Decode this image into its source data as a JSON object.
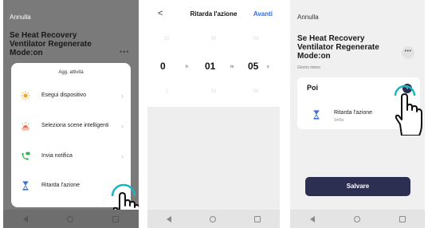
{
  "screen1": {
    "cancel": "Annulla",
    "title": "Se Heat Recovery Ventilator Regenerate Mode:on",
    "more": "•••",
    "sheet_title": "Agg. attività",
    "items": [
      {
        "label": "Esegui dispositivo",
        "icon": "sun-device-icon",
        "color": "#f5a623"
      },
      {
        "label": "Seleziona scene intelligenti",
        "icon": "sunrise-scene-icon",
        "color": "#f06a3c"
      },
      {
        "label": "Invia notifica",
        "icon": "phone-message-icon",
        "color": "#2db34a"
      },
      {
        "label": "Ritarda l'azione",
        "icon": "hourglass-icon",
        "color": "#3a6fd8"
      }
    ],
    "chevron": "›"
  },
  "screen2": {
    "back": "<",
    "title": "Ritarda l'azione",
    "next": "Avanti",
    "picker": {
      "hours": "0",
      "hours_unit": "h",
      "minutes": "01",
      "minutes_unit": "m",
      "seconds": "05",
      "seconds_unit": "s",
      "above": [
        "23",
        "00",
        "04"
      ],
      "top": [
        "22",
        "59",
        "03"
      ],
      "below": [
        "1",
        "02",
        "06"
      ]
    }
  },
  "screen3": {
    "cancel": "Annulla",
    "title": "Se Heat Recovery Ventilator Regenerate Mode:on",
    "subtitle": "Giorno intero",
    "more": "•••",
    "poi_label": "Poi",
    "add": "+",
    "action_label": "Ritarda l'azione",
    "action_value": "1m5s",
    "save": "Salvare"
  },
  "colors": {
    "accent_blue": "#2f6fe0",
    "button_dark": "#2d2f52",
    "touch_ring": "#17b6c4"
  }
}
